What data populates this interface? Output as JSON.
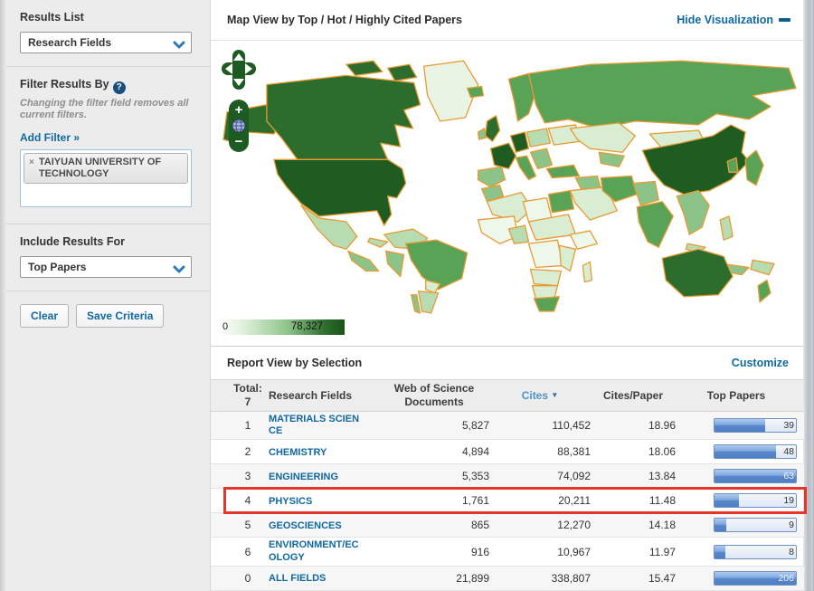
{
  "sidebar": {
    "results_list": {
      "heading": "Results List",
      "dropdown_value": "Research Fields"
    },
    "filter_by": {
      "heading": "Filter Results By",
      "help_icon": "?",
      "note_line": "Changing the filter field removes all current filters.",
      "add_filter_link": "Add Filter »",
      "filter_tag": {
        "remove_icon": "×",
        "label": "TAIYUAN UNIVERSITY OF TECHNOLOGY"
      }
    },
    "include_results": {
      "heading": "Include Results For",
      "dropdown_value": "Top Papers"
    },
    "actions": {
      "clear_label": "Clear",
      "save_label": "Save Criteria"
    }
  },
  "map_section": {
    "title": "Map View by Top / Hot / Highly Cited Papers",
    "hide_visualization_label": "Hide Visualization",
    "controls": {
      "zoom_in": "+",
      "zoom_out": "−"
    },
    "legend": {
      "min_label": "0",
      "max_label": "78,327"
    }
  },
  "report_section": {
    "title": "Report View by Selection",
    "customize_label": "Customize",
    "header": {
      "total_line1": "Total:",
      "total_line2": "7",
      "research_fields": "Research Fields",
      "documents_line1": "Web of Science",
      "documents_line2": "Documents",
      "cites": "Cites",
      "sort_icon": "▼",
      "cites_per_paper": "Cites/Paper",
      "top_papers": "Top Papers"
    },
    "rows": [
      {
        "rank": "1",
        "field": "MATERIALS SCIENCE",
        "docs": "5,827",
        "cites": "110,452",
        "cites_per_paper": "18.96",
        "top_papers": "39",
        "bar_pct": 62,
        "highlighted": false
      },
      {
        "rank": "2",
        "field": "CHEMISTRY",
        "docs": "4,894",
        "cites": "88,381",
        "cites_per_paper": "18.06",
        "top_papers": "48",
        "bar_pct": 76,
        "highlighted": false
      },
      {
        "rank": "3",
        "field": "ENGINEERING",
        "docs": "5,353",
        "cites": "74,092",
        "cites_per_paper": "13.84",
        "top_papers": "63",
        "bar_pct": 100,
        "highlighted": false
      },
      {
        "rank": "4",
        "field": "PHYSICS",
        "docs": "1,761",
        "cites": "20,211",
        "cites_per_paper": "11.48",
        "top_papers": "19",
        "bar_pct": 30,
        "highlighted": true
      },
      {
        "rank": "5",
        "field": "GEOSCIENCES",
        "docs": "865",
        "cites": "12,270",
        "cites_per_paper": "14.18",
        "top_papers": "9",
        "bar_pct": 14,
        "highlighted": false
      },
      {
        "rank": "6",
        "field": "ENVIRONMENT/ECOLOGY",
        "docs": "916",
        "cites": "10,967",
        "cites_per_paper": "11.97",
        "top_papers": "8",
        "bar_pct": 13,
        "highlighted": false
      },
      {
        "rank": "0",
        "field": "ALL FIELDS",
        "docs": "21,899",
        "cites": "338,807",
        "cites_per_paper": "15.47",
        "top_papers": "206",
        "bar_pct": 100,
        "highlighted": false
      }
    ]
  },
  "colors": {
    "link_blue": "#0e6a9e",
    "map_border_orange": "#e89b33",
    "map_green_darkest": "#1e5c22",
    "map_green_dark": "#2c6c2c",
    "map_green_medium": "#58a356",
    "map_green_light": "#b8dcb2",
    "map_green_pale": "#d9edd2",
    "highlight_red": "#e8352b",
    "bar_blue": "#4f80c4"
  }
}
